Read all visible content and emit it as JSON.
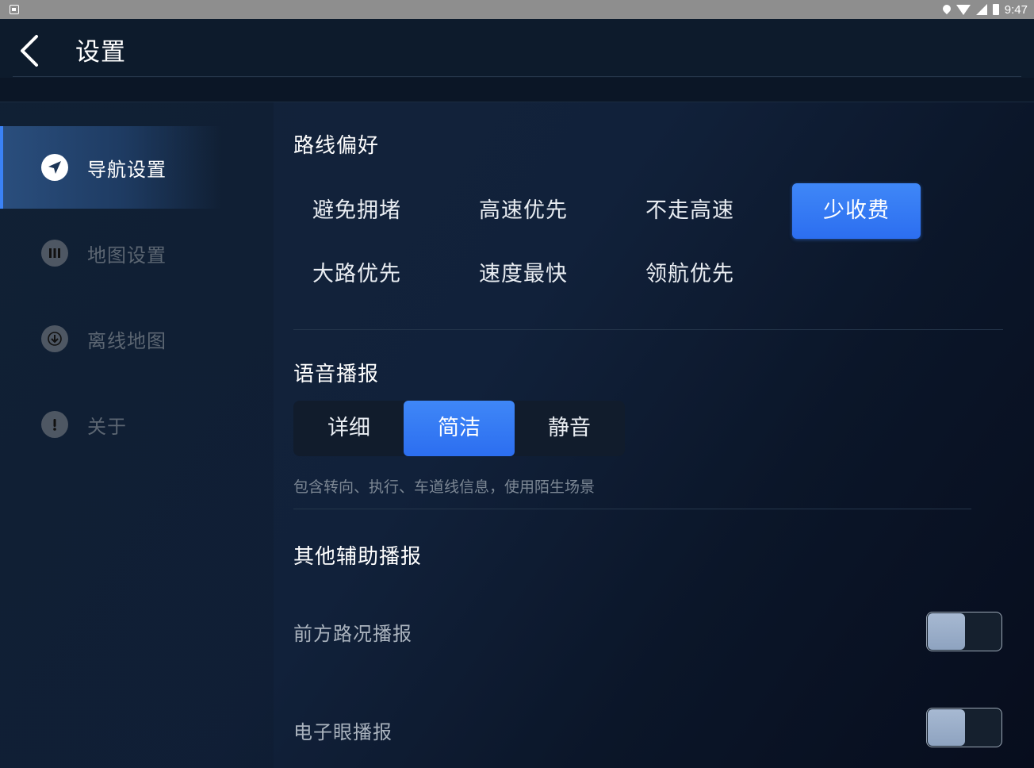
{
  "status_bar": {
    "time": "9:47",
    "icons": [
      "notification-icon",
      "location-pin-icon",
      "wifi-icon",
      "cell-signal-icon",
      "battery-icon"
    ]
  },
  "header": {
    "title": "设置",
    "back_icon": "chevron-left-icon"
  },
  "sidebar": {
    "items": [
      {
        "label": "导航设置",
        "icon": "navigation-arrow-icon",
        "active": true
      },
      {
        "label": "地图设置",
        "icon": "map-icon",
        "active": false
      },
      {
        "label": "离线地图",
        "icon": "download-icon",
        "active": false
      },
      {
        "label": "关于",
        "icon": "info-exclamation-icon",
        "active": false
      }
    ]
  },
  "route_preference": {
    "title": "路线偏好",
    "options": [
      {
        "label": "避免拥堵",
        "selected": false
      },
      {
        "label": "高速优先",
        "selected": false
      },
      {
        "label": "不走高速",
        "selected": false
      },
      {
        "label": "少收费",
        "selected": true
      },
      {
        "label": "大路优先",
        "selected": false
      },
      {
        "label": "速度最快",
        "selected": false
      },
      {
        "label": "领航优先",
        "selected": false
      }
    ]
  },
  "voice_broadcast": {
    "title": "语音播报",
    "options": [
      {
        "label": "详细",
        "selected": false
      },
      {
        "label": "简洁",
        "selected": true
      },
      {
        "label": "静音",
        "selected": false
      }
    ],
    "hint": "包含转向、执行、车道线信息，使用陌生场景"
  },
  "other_broadcast": {
    "title": "其他辅助播报",
    "items": [
      {
        "label": "前方路况播报",
        "enabled": false
      },
      {
        "label": "电子眼播报",
        "enabled": false
      }
    ]
  },
  "colors": {
    "accent": "#3b82f6",
    "background": "#0b1626",
    "sidebar_active": "#2a4e7d"
  }
}
